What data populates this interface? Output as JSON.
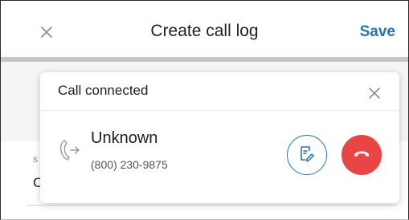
{
  "header": {
    "title": "Create call log",
    "save_label": "Save",
    "close_icon": "close-icon"
  },
  "background_form": {
    "field_label_partial": "s",
    "field_value_partial": "C"
  },
  "call_card": {
    "status": "Call connected",
    "caller_name": "Unknown",
    "caller_number": "(800) 230-9875",
    "icons": {
      "dismiss": "close-icon",
      "direction": "outgoing-call-icon",
      "notes": "notes-icon",
      "hangup": "hang-up-icon"
    }
  },
  "colors": {
    "accent": "#1f75b4",
    "hangup": "#e94545",
    "header_divider": "#c6c6c6"
  }
}
